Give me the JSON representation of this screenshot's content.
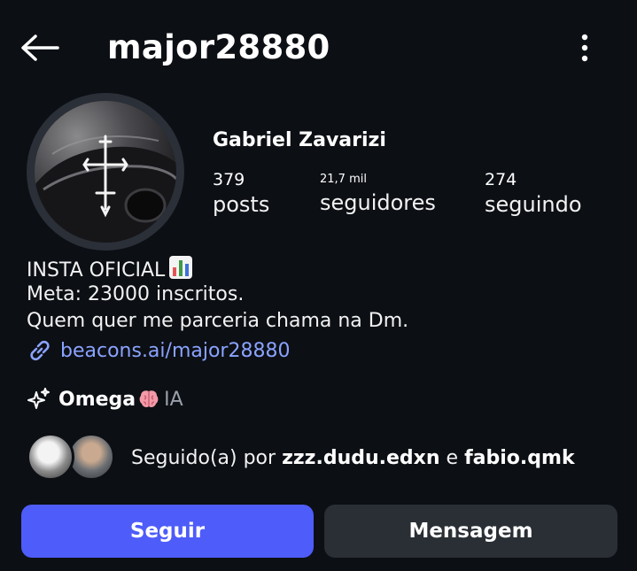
{
  "header": {
    "username": "major28880",
    "back_icon": "arrow-left-icon",
    "more_icon": "vertical-dots-icon"
  },
  "profile": {
    "full_name": "Gabriel Zavarizi",
    "stats": [
      {
        "value": "379",
        "label": "posts"
      },
      {
        "value": "21,7 mil",
        "label": "seguidores"
      },
      {
        "value": "274",
        "label": "seguindo"
      }
    ]
  },
  "bio": {
    "line1": "INSTA OFICIAL",
    "line1_emoji": "bar-chart-emoji",
    "line2": "Meta: 23000 inscritos.",
    "line3": "Quem quer me parceria chama na Dm.",
    "link": "beacons.ai/major28880"
  },
  "ai": {
    "name": "Omega",
    "emoji": "brain-emoji",
    "tag": "IA"
  },
  "followed_by": {
    "prefix": "Seguido(a) por",
    "user1": "zzz.dudu.edxn",
    "conjunction": "e",
    "user2": "fabio.qmk"
  },
  "actions": {
    "follow": "Seguir",
    "message": "Mensagem"
  },
  "colors": {
    "background": "#0c0f14",
    "follow_button": "#4e5cf9",
    "message_button": "#2a2e35",
    "link": "#8aa3ff"
  }
}
